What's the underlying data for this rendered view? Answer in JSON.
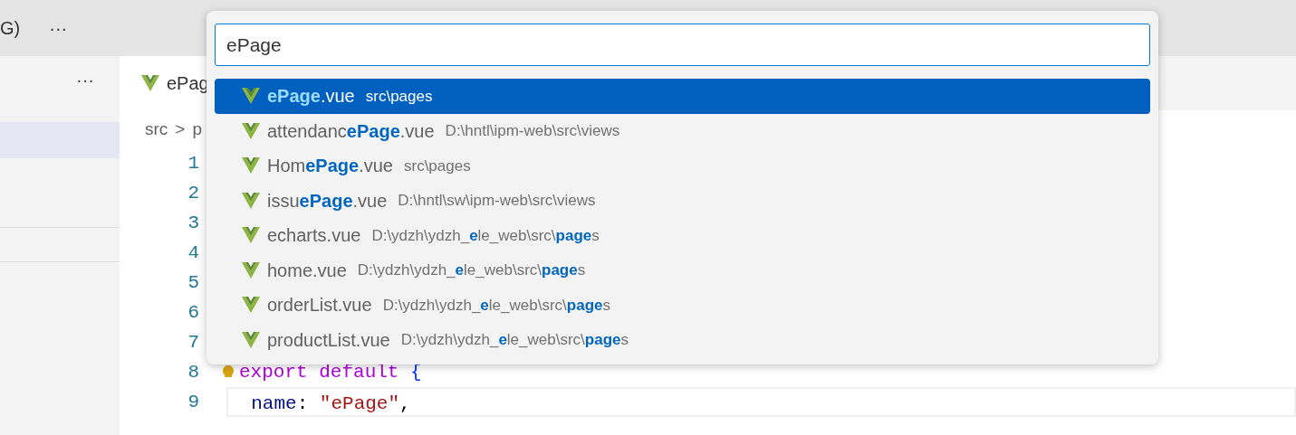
{
  "title_bar": {
    "title_fragment": "G)",
    "more": "···"
  },
  "sidebar": {
    "more": "···"
  },
  "editor": {
    "tab": {
      "label": "ePag",
      "selected": true
    },
    "breadcrumb": [
      "src",
      "p"
    ],
    "breadcrumb_separator": ">",
    "lines": [
      {
        "number": "1",
        "current": false
      },
      {
        "number": "2",
        "current": false
      },
      {
        "number": "3",
        "current": false
      },
      {
        "number": "4",
        "current": false
      },
      {
        "number": "5",
        "current": false
      },
      {
        "number": "6",
        "current": false
      },
      {
        "number": "7",
        "current": false
      },
      {
        "number": "8",
        "current": false,
        "tokens": [
          {
            "kind": "keyword",
            "text": "export"
          },
          {
            "kind": "keyword",
            "text": " default"
          },
          {
            "kind": "bracket",
            "text": " {"
          }
        ]
      },
      {
        "number": "9",
        "current": true,
        "tokens": [
          {
            "kind": "property",
            "text": "  name"
          },
          {
            "kind": "plain",
            "text": ": "
          },
          {
            "kind": "string",
            "text": "\"ePage\""
          },
          {
            "kind": "plain",
            "text": ","
          }
        ]
      }
    ]
  },
  "quick_open": {
    "query": "ePage",
    "results": [
      {
        "label": "**ePage**.vue",
        "description": "src\\pages",
        "selected": true
      },
      {
        "label": "attendanc**ePage**.vue",
        "description": "D:\\hntl\\ipm-web\\src\\views",
        "selected": false
      },
      {
        "label": "Hom**ePage**.vue",
        "description": "src\\pages",
        "selected": false
      },
      {
        "label": "issu**ePage**.vue",
        "description": "D:\\hntl\\sw\\ipm-web\\src\\views",
        "selected": false
      },
      {
        "label": "echarts.vue",
        "description": "D:\\ydzh\\ydzh_**e**le_web\\src\\**page**s",
        "selected": false
      },
      {
        "label": "home.vue",
        "description": "D:\\ydzh\\ydzh_**e**le_web\\src\\**page**s",
        "selected": false
      },
      {
        "label": "orderList.vue",
        "description": "D:\\ydzh\\ydzh_**e**le_web\\src\\**page**s",
        "selected": false
      },
      {
        "label": "productList.vue",
        "description": "D:\\ydzh\\ydzh_**e**le_web\\src\\**page**s",
        "selected": false
      }
    ]
  }
}
